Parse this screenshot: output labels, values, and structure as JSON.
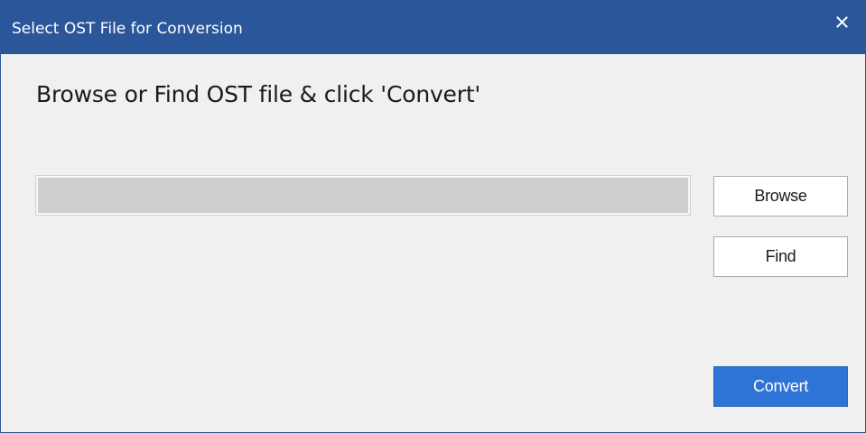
{
  "window": {
    "title": "Select OST File for Conversion",
    "close_icon": "close-icon",
    "accent_color": "#2b579a"
  },
  "main": {
    "heading": "Browse or Find OST file & click 'Convert'",
    "file_path": {
      "value": "",
      "placeholder": ""
    }
  },
  "buttons": {
    "browse_label": "Browse",
    "find_label": "Find",
    "convert_label": "Convert",
    "convert_color": "#2e74d6"
  }
}
